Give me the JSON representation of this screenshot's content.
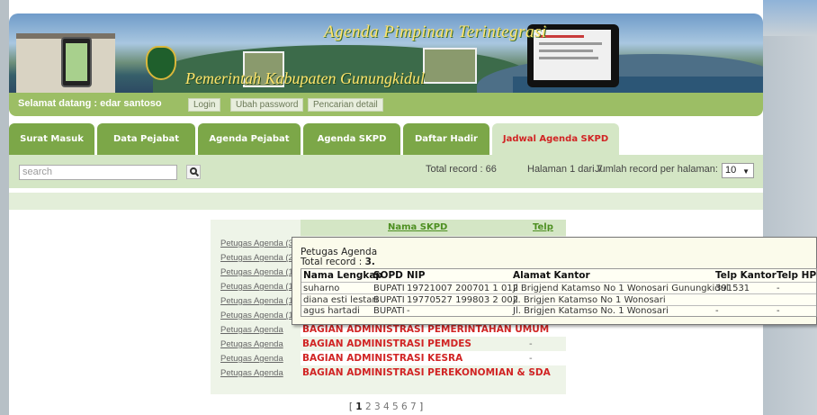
{
  "banner": {
    "title": "Agenda Pimpinan Terintegrasi",
    "subtitle": "Pemerintah Kabupaten Gunungkidul"
  },
  "greeting": {
    "text": "Selamat datang : edar santoso",
    "buttons": [
      "Login",
      "Ubah password",
      "Pencarian detail"
    ]
  },
  "tabs": [
    {
      "label": "Surat Masuk"
    },
    {
      "label": "Data Pejabat"
    },
    {
      "label": "Agenda Pejabat"
    },
    {
      "label": "Agenda SKPD"
    },
    {
      "label": "Daftar Hadir"
    },
    {
      "label": "Jadwal Agenda SKPD",
      "active": true
    }
  ],
  "search": {
    "placeholder": "search",
    "total_record": "Total record : 66",
    "page_info": "Halaman 1 dari 7",
    "per_page_label": "Jumlah record per halaman:",
    "per_page_value": "10"
  },
  "table": {
    "col_name": "Nama SKPD",
    "col_telp": "Telp",
    "rows": [
      {
        "link": "Petugas Agenda (3)",
        "skpd": "",
        "telp": ""
      },
      {
        "link": "Petugas Agenda (2)",
        "skpd": "",
        "telp": ""
      },
      {
        "link": "Petugas Agenda (1)",
        "skpd": "",
        "telp": ""
      },
      {
        "link": "Petugas Agenda (1)",
        "skpd": "",
        "telp": ""
      },
      {
        "link": "Petugas Agenda (1)",
        "skpd": "",
        "telp": ""
      },
      {
        "link": "Petugas Agenda (1)",
        "skpd": "",
        "telp": ""
      },
      {
        "link": "Petugas Agenda",
        "skpd": "BAGIAN ADMINISTRASI PEMERINTAHAN UMUM",
        "telp": "-"
      },
      {
        "link": "Petugas Agenda",
        "skpd": "BAGIAN ADMINISTRASI PEMDES",
        "telp": "-"
      },
      {
        "link": "Petugas Agenda",
        "skpd": "BAGIAN ADMINISTRASI KESRA",
        "telp": "-"
      },
      {
        "link": "Petugas Agenda",
        "skpd": "BAGIAN ADMINISTRASI PEREKONOMIAN & SDA",
        "telp": "-"
      }
    ]
  },
  "pager": {
    "open": "[",
    "current": "1",
    "pages": "2 3 4 5 6 7",
    "close": "]"
  },
  "popup": {
    "title": "Petugas Agenda",
    "total_label": "Total record :",
    "total_value": "3.",
    "headers": [
      "Nama Lengkap",
      "SOPD",
      "NIP",
      "Alamat Kantor",
      "Telp Kantor",
      "Telp HP"
    ],
    "rows": [
      [
        "suharno",
        "BUPATI",
        "19721007 200701 1 012",
        "Jl Brigjend Katamso No 1 Wonosari Gunungkidul",
        "391531",
        "-"
      ],
      [
        "diana esti lestari",
        "BUPATI",
        "19770527 199803 2 002",
        "jl. Brigjen Katamso No 1 Wonosari",
        "",
        ""
      ],
      [
        "agus hartadi",
        "BUPATI",
        "-",
        "Jl. Brigjen Katamso No. 1 Wonosari",
        "-",
        "-"
      ]
    ]
  },
  "colors": {
    "green": "#9cbe65",
    "tab_green": "#7ca748",
    "light_green": "#d4e6c5",
    "accent_red": "#d12424"
  }
}
